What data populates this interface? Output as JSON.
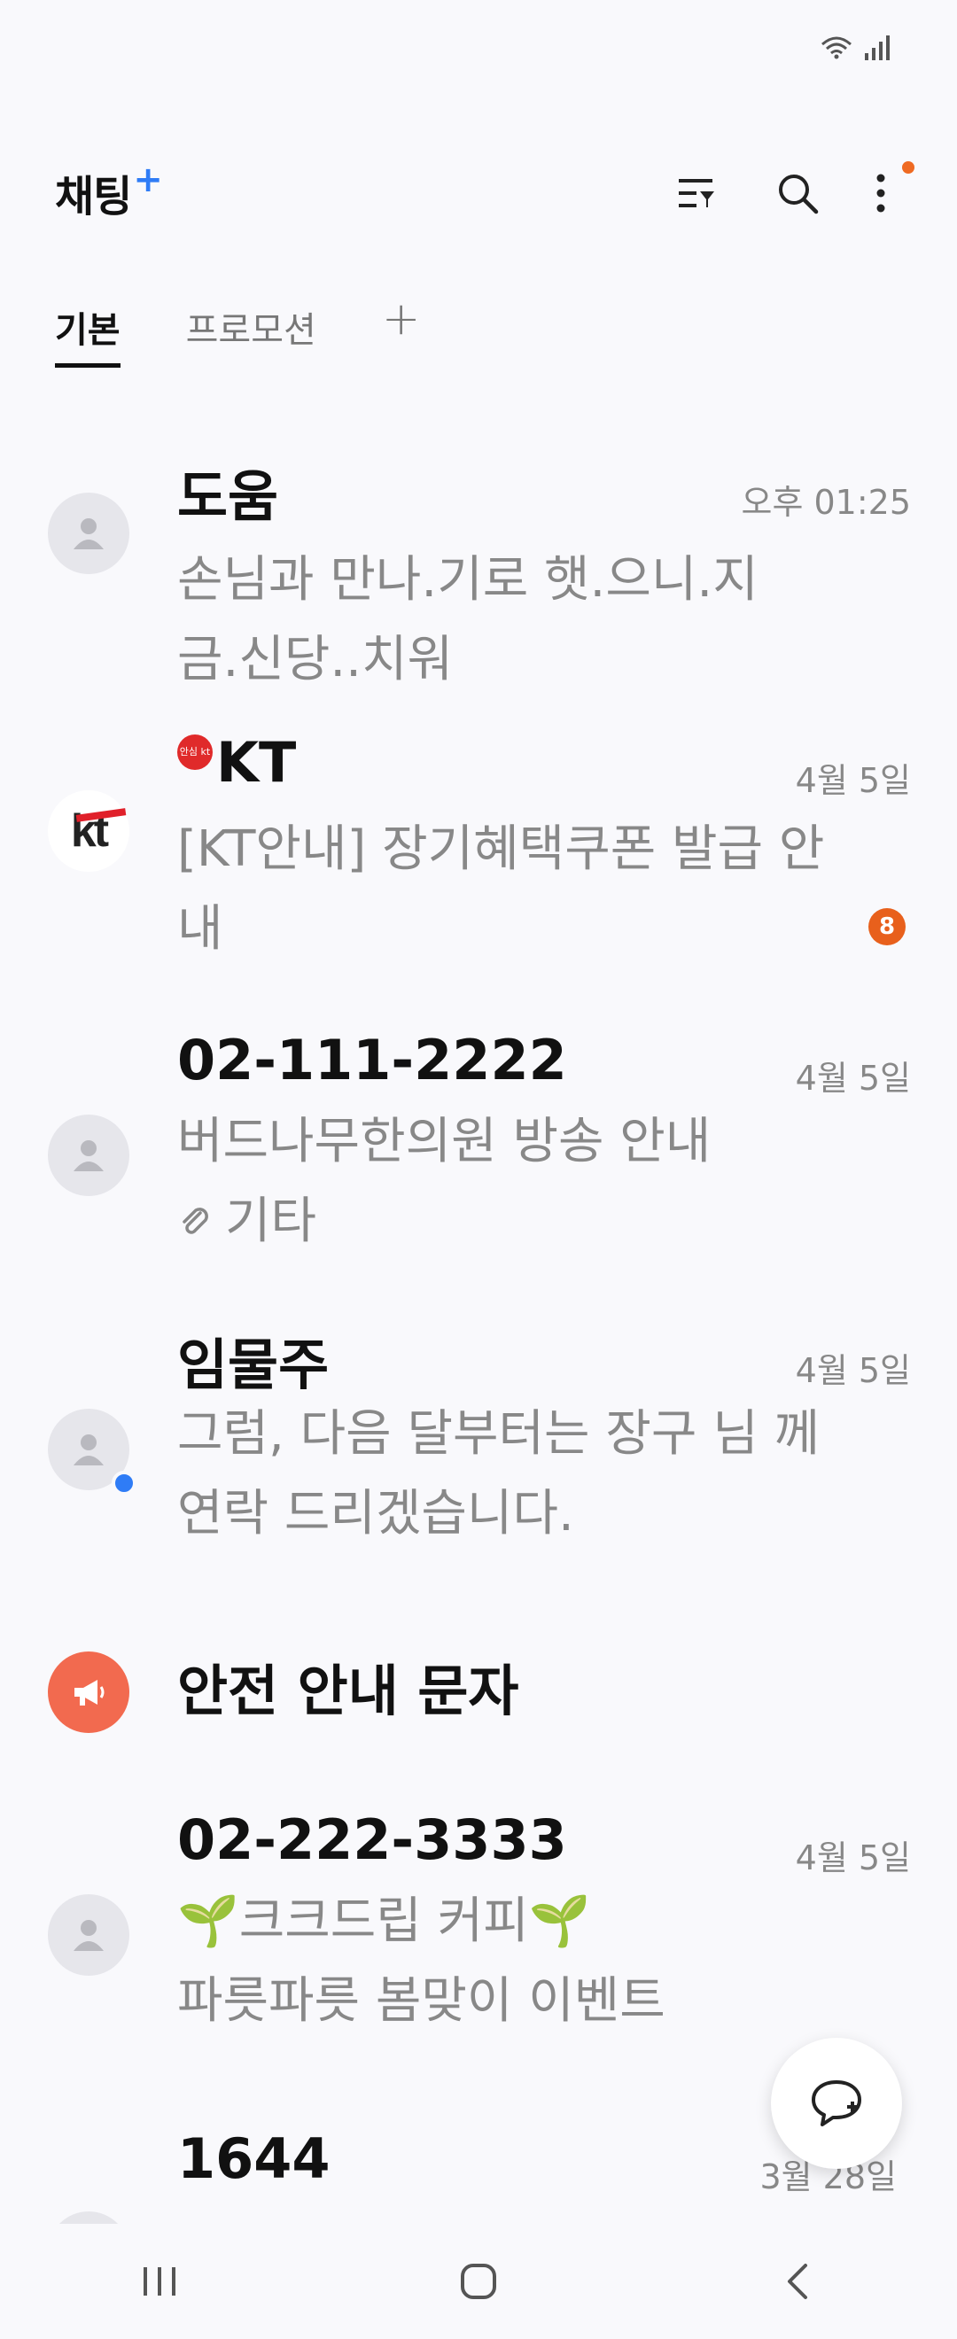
{
  "app": {
    "title": "채팅",
    "title_plus": "+"
  },
  "tabs": [
    {
      "label": "기본",
      "active": true
    },
    {
      "label": "프로모션",
      "active": false
    }
  ],
  "tab_add_label": "+",
  "conversations": [
    {
      "name": "도움",
      "time": "오후 01:25",
      "preview": "손님과 만나.기로 햇.으니.지 금.신당..치워",
      "avatar": "person"
    },
    {
      "name": "KT",
      "time": "4월 5일",
      "preview": "[KT안내] 장기혜택쿠폰 발급 안내",
      "badge": "8",
      "avatar": "kt-logo",
      "secure_badge": "안심 kt"
    },
    {
      "name": "02-111-2222",
      "time": "4월 5일",
      "preview": "버드나무한의원 방송 안내",
      "attachment_label": "기타",
      "avatar": "person"
    },
    {
      "name": "임물주",
      "time": "4월 5일",
      "preview": "그럼, 다음 달부터는 장구 님 께 연락 드리겠습니다.",
      "avatar": "person",
      "online": true
    },
    {
      "name": "안전 안내 문자",
      "avatar": "megaphone"
    },
    {
      "name": "02-222-3333",
      "time": "4월 5일",
      "preview_line1": "🌱크크드립 커피🌱",
      "preview_line2": "파릇파릇 봄맞이 이벤트",
      "avatar": "person"
    },
    {
      "name": "1644",
      "time": "3월 28일",
      "avatar": "person"
    }
  ],
  "colors": {
    "accent": "#2f7cf6",
    "badge": "#e8601c",
    "alert_avatar": "#f26a4f"
  },
  "icons": [
    "wifi-icon",
    "signal-icon",
    "filter-icon",
    "search-icon",
    "more-icon",
    "person-icon",
    "megaphone-icon",
    "attachment-icon",
    "new-chat-icon"
  ]
}
